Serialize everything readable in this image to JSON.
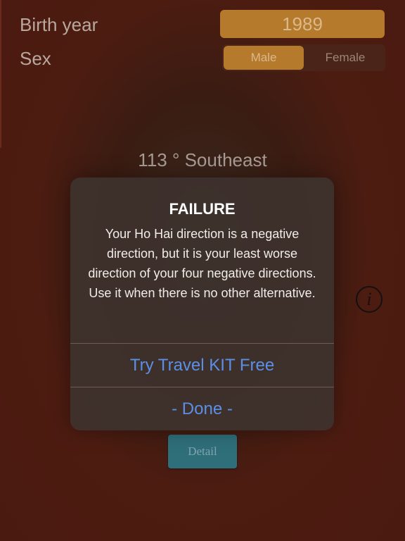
{
  "form": {
    "birth_year_label": "Birth year",
    "birth_year_value": "1989",
    "sex_label": "Sex",
    "sex_options": [
      "Male",
      "Female"
    ],
    "sex_selected": "Male"
  },
  "result": {
    "direction_text": "113 ° Southeast"
  },
  "info_icon": "i",
  "detail_button_label": "Detail",
  "alert": {
    "title": "FAILURE",
    "message": "Your Ho Hai direction is a negative direction, but it is your least worse direction of your four negative directions. Use it when there is no other alternative.",
    "actions": [
      "Try Travel KIT Free",
      "- Done -"
    ]
  },
  "colors": {
    "background": "#541d12",
    "accent": "#b57a2c",
    "link": "#5b8fe6",
    "detail_button": "#2f6f7a"
  }
}
